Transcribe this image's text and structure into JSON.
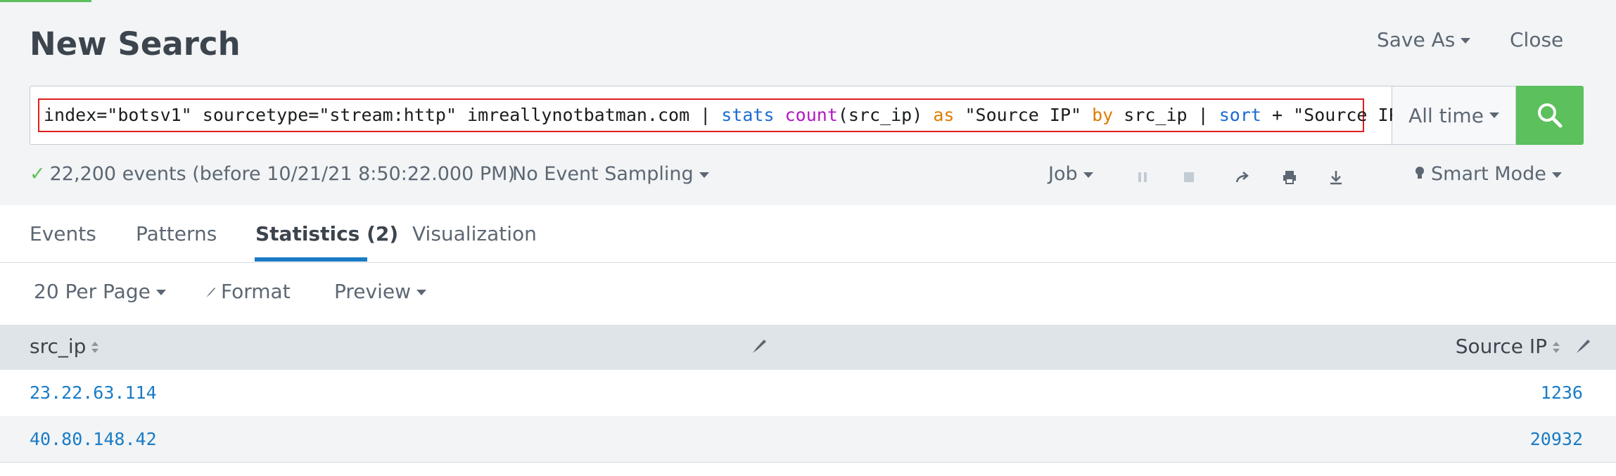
{
  "header": {
    "title": "New Search",
    "save_as_label": "Save As",
    "close_label": "Close"
  },
  "search": {
    "query_parts": {
      "p1": "index=\"botsv1\" sourcetype=\"stream:http\" imreallynotbatman.com | ",
      "stats": "stats",
      "sp1": " ",
      "count": "count",
      "p2": "(src_ip) ",
      "as": "as",
      "p3": " \"Source IP\" ",
      "by": "by",
      "p4": " src_ip | ",
      "sort": "sort",
      "p5": " + \"Source IP\""
    },
    "time_range": "All time",
    "submit_icon": "search-icon"
  },
  "status": {
    "events_summary": "22,200 events (before 10/21/21 8:50:22.000 PM)",
    "sampling_label": "No Event Sampling",
    "job_label": "Job",
    "mode_label": "Smart Mode"
  },
  "tabs": [
    {
      "label": "Events"
    },
    {
      "label": "Patterns"
    },
    {
      "label": "Statistics (2)"
    },
    {
      "label": "Visualization"
    }
  ],
  "controls": {
    "per_page_label": "20 Per Page",
    "format_label": "Format",
    "preview_label": "Preview"
  },
  "table": {
    "columns": [
      "src_ip",
      "Source IP"
    ],
    "rows": [
      {
        "src_ip": "23.22.63.114",
        "source_ip": "1236"
      },
      {
        "src_ip": "40.80.148.42",
        "source_ip": "20932"
      }
    ]
  },
  "colors": {
    "accent_green": "#5cc05c",
    "link_blue": "#1a7bc5",
    "highlight_red": "#e01e1e"
  }
}
